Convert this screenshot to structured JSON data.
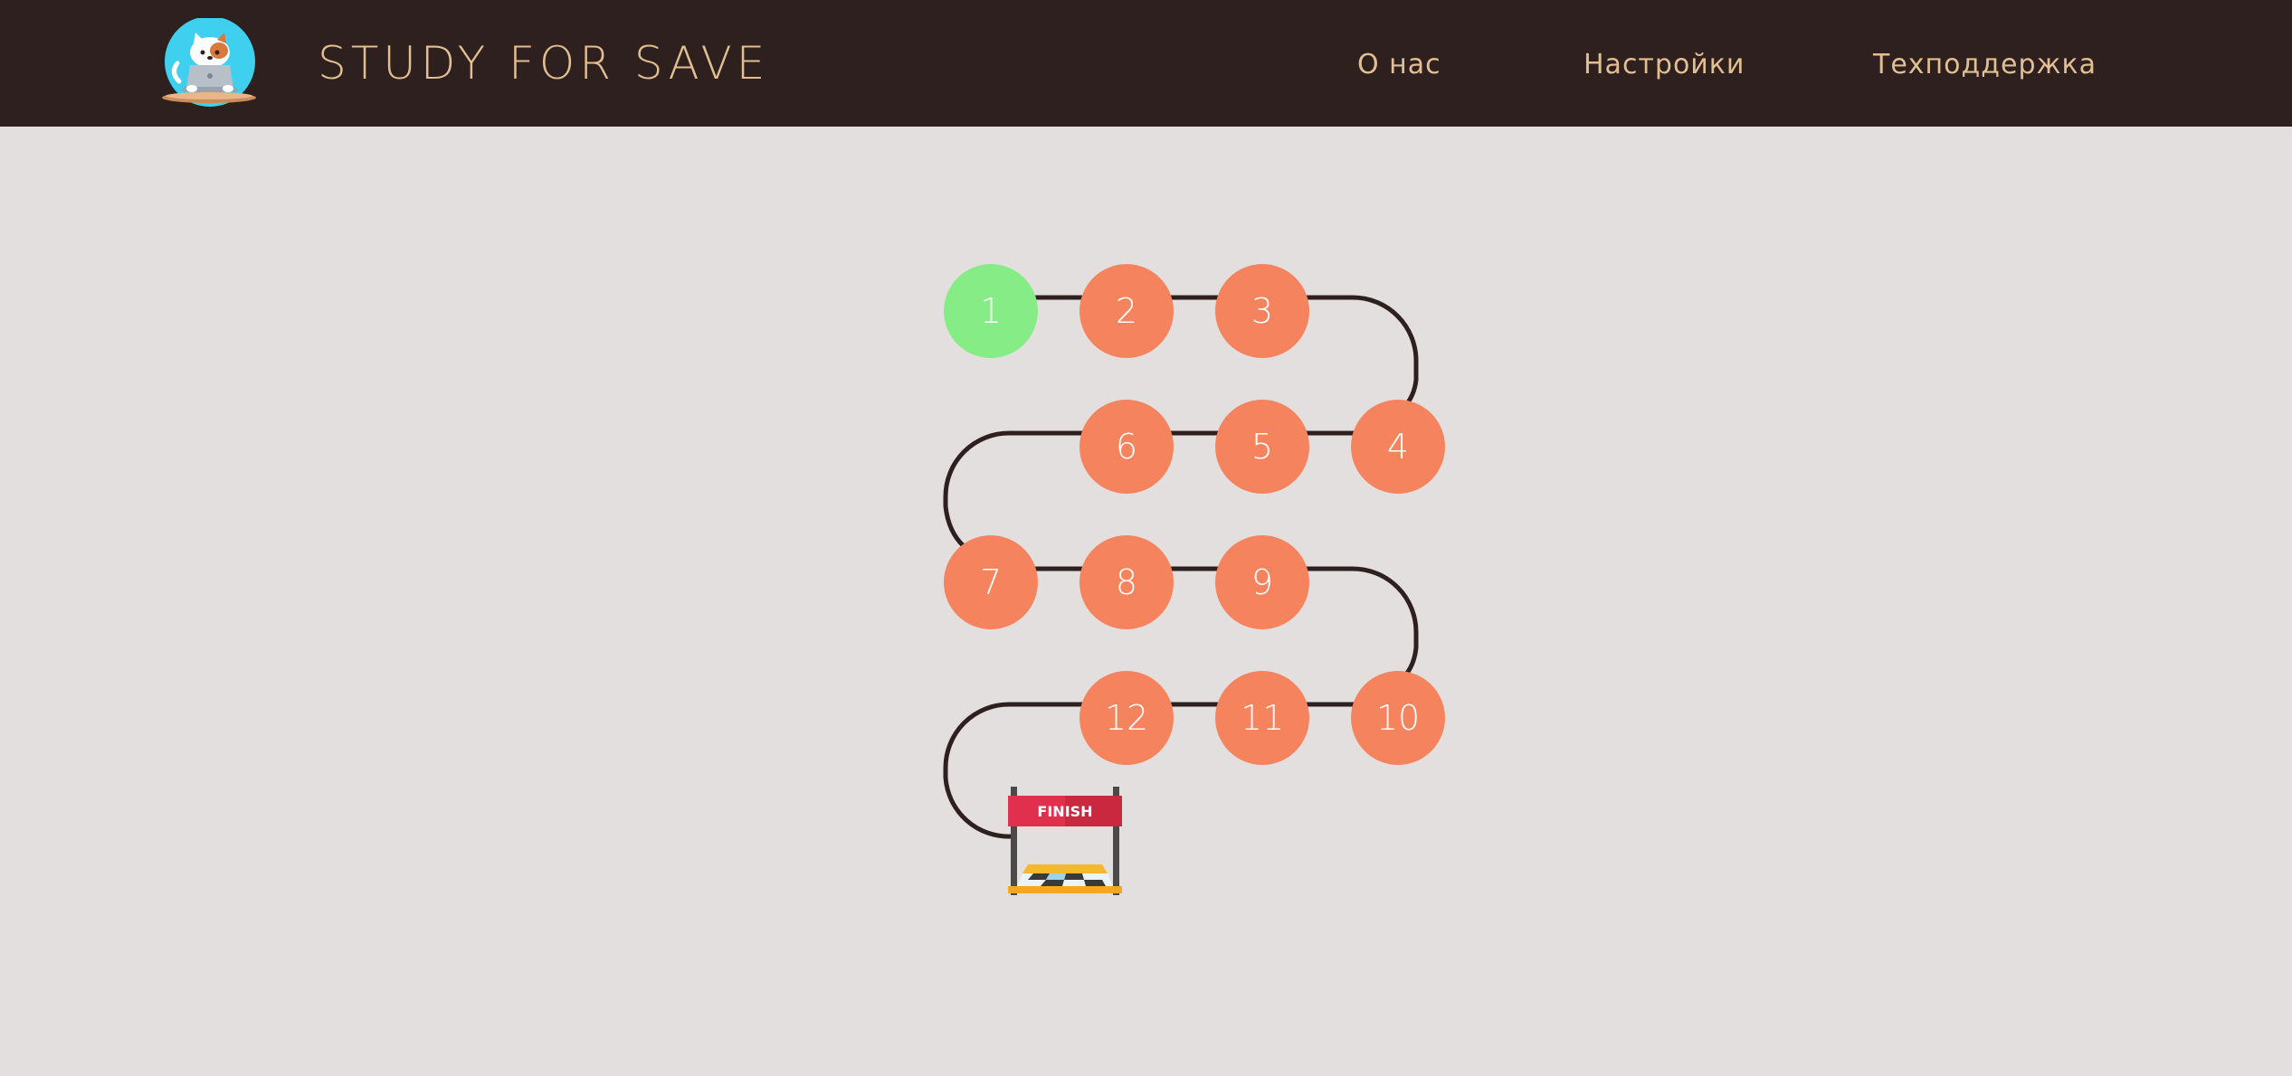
{
  "header": {
    "title": "STUDY FOR SAVE",
    "nav": {
      "about": "О нас",
      "settings": "Настройки",
      "support": "Техподдержка"
    }
  },
  "colors": {
    "header_bg": "#2e201e",
    "page_bg": "#e4dfdf",
    "nav_text": "#e2bf93",
    "level_done": "#86ec86",
    "level_locked": "#f5835d",
    "path_line": "#2e201e"
  },
  "levels": [
    {
      "label": "1",
      "status": "done"
    },
    {
      "label": "2",
      "status": "locked"
    },
    {
      "label": "3",
      "status": "locked"
    },
    {
      "label": "4",
      "status": "locked"
    },
    {
      "label": "5",
      "status": "locked"
    },
    {
      "label": "6",
      "status": "locked"
    },
    {
      "label": "7",
      "status": "locked"
    },
    {
      "label": "8",
      "status": "locked"
    },
    {
      "label": "9",
      "status": "locked"
    },
    {
      "label": "10",
      "status": "locked"
    },
    {
      "label": "11",
      "status": "locked"
    },
    {
      "label": "12",
      "status": "locked"
    }
  ],
  "finish": {
    "label": "FINISH"
  }
}
